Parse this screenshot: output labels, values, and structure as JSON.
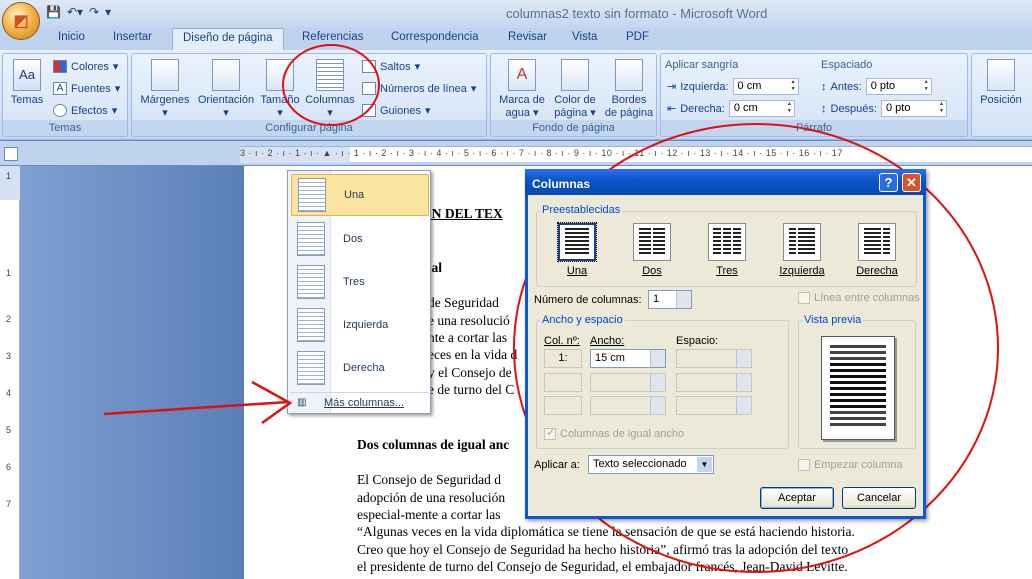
{
  "window": {
    "title": "columnas2 texto sin formato - Microsoft Word"
  },
  "tabs": [
    "Inicio",
    "Insertar",
    "Diseño de página",
    "Referencias",
    "Correspondencia",
    "Revisar",
    "Vista",
    "PDF"
  ],
  "ribbon": {
    "temas": {
      "btn": "Temas",
      "colores": "Colores",
      "fuentes": "Fuentes",
      "efectos": "Efectos",
      "label": "Temas"
    },
    "configurar": {
      "margenes": "Márgenes",
      "orientacion": "Orientación",
      "tamano": "Tamaño",
      "columnas": "Columnas",
      "saltos": "Saltos",
      "numeros": "Números de línea",
      "guiones": "Guiones",
      "label": "Configurar página"
    },
    "fondo": {
      "marca1": "Marca de",
      "marca2": "agua",
      "color1": "Color de",
      "color2": "página",
      "bordes1": "Bordes",
      "bordes2": "de página",
      "label": "Fondo de página"
    },
    "parrafo": {
      "sangria": "Aplicar sangría",
      "izq": "Izquierda:",
      "izq_val": "0 cm",
      "der": "Derecha:",
      "der_val": "0 cm",
      "espaciado": "Espaciado",
      "antes": "Antes:",
      "antes_val": "0 pto",
      "despues": "Después:",
      "despues_val": "0 pto",
      "label": "Párrafo"
    },
    "posicion": "Posición"
  },
  "ruler": {
    "h": "3 · ı · 2 · ı · 1 · ı · ▲ · ı · 1 · ı · 2 · ı · 3 · ı · 4 · ı · 5 · ı · 6 · ı · 7 · ı · 8 · ı · 9 · ı · 10 · ı · 11 · ı · 12 · ı · 13 · ı · 14 · ı · 15 · ı · 16 · ı · 17",
    "v": [
      "1",
      "1",
      "2",
      "3",
      "4",
      "5",
      "6",
      "7"
    ]
  },
  "document": {
    "heading": "IÓN DEL TEX",
    "sub1": "nal",
    "p1": [
      "de  Seguridad",
      "e una resolució",
      "nte a cortar las",
      "eces en la vida d",
      "y el Consejo de",
      "e de turno del C"
    ],
    "heading2": "Dos columnas de igual anc",
    "p2": [
      " El Consejo de Seguridad d",
      "adopción de una resolución",
      "especial-mente a cortar las",
      "“Algunas veces en la vida diplomática se tiene la sensación de que se está haciendo historia.",
      "Creo que hoy el Consejo de Seguridad ha hecho historia”, afirmó tras la adopción del texto",
      "el presidente de turno del Consejo de Seguridad, el embajador francés, Jean-David Levitte."
    ]
  },
  "menu": {
    "items": [
      "Una",
      "Dos",
      "Tres",
      "Izquierda",
      "Derecha"
    ],
    "more": "Más columnas..."
  },
  "dialog": {
    "title": "Columnas",
    "help": "?",
    "close": "✕",
    "preestablecidas": "Preestablecidas",
    "presets": [
      "Una",
      "Dos",
      "Tres",
      "Izquierda",
      "Derecha"
    ],
    "num_label": "Número de columnas:",
    "num_val": "1",
    "linea": "Línea entre columnas",
    "ancho_group": "Ancho y espacio",
    "col_no": "Col. nº:",
    "ancho": "Ancho:",
    "espacio": "Espacio:",
    "row1_col": "1:",
    "row1_ancho": "15 cm",
    "igual": "Columnas de igual ancho",
    "vista": "Vista previa",
    "aplicar": "Aplicar a:",
    "aplicar_val": "Texto seleccionado",
    "empezar": "Empezar columna",
    "aceptar": "Aceptar",
    "cancelar": "Cancelar"
  }
}
